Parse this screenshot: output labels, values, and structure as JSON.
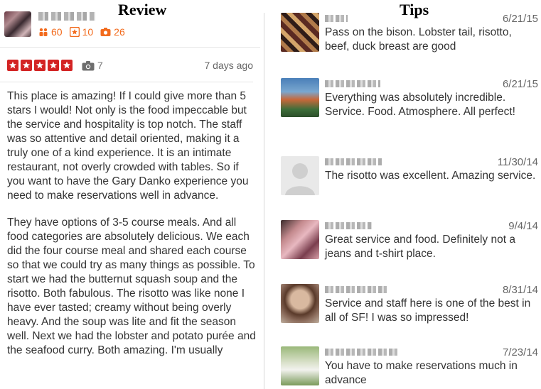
{
  "headings": {
    "review": "Review",
    "tips": "Tips"
  },
  "reviewer": {
    "friends": "60",
    "reviews": "10",
    "photos": "26"
  },
  "review": {
    "stars": 5,
    "photo_count": "7",
    "date": "7 days ago",
    "paragraphs": [
      "This place is amazing! If I could give more than 5 stars I would! Not only is the food impeccable but the service and hospitality is top notch. The staff was so attentive and detail oriented, making it a truly one of a kind experience. It is an intimate restaurant, not overly crowded with tables. So if you want to have the Gary Danko experience you need to make reservations well in advance.",
      "They have options of 3-5 course meals. And all food categories are absolutely delicious. We each did the four course meal and shared each course so that we could try as many things as possible. To start we had the butternut squash soup and the risotto. Both fabulous. The risotto was like none I have ever tasted; creamy without being overly heavy. And the soup was lite and fit the season well. Next we had the lobster and potato purée and the seafood curry. Both amazing. I'm usually"
    ]
  },
  "tips": [
    {
      "date": "6/21/15",
      "text": "Pass on the bison. Lobster tail, risotto, beef, duck breast are good"
    },
    {
      "date": "6/21/15",
      "text": "Everything was absolutely incredible. Service. Food. Atmosphere.  All perfect!"
    },
    {
      "date": "11/30/14",
      "text": "The risotto was excellent. Amazing service."
    },
    {
      "date": "9/4/14",
      "text": "Great service and food. Definitely not a jeans and t-shirt place."
    },
    {
      "date": "8/31/14",
      "text": "Service and staff here is one of the best in all of SF! I was so impressed!"
    },
    {
      "date": "7/23/14",
      "text": "You have to make reservations much in advance"
    }
  ],
  "colors": {
    "star_red": "#d32323",
    "stat_orange": "#f26b1d"
  }
}
